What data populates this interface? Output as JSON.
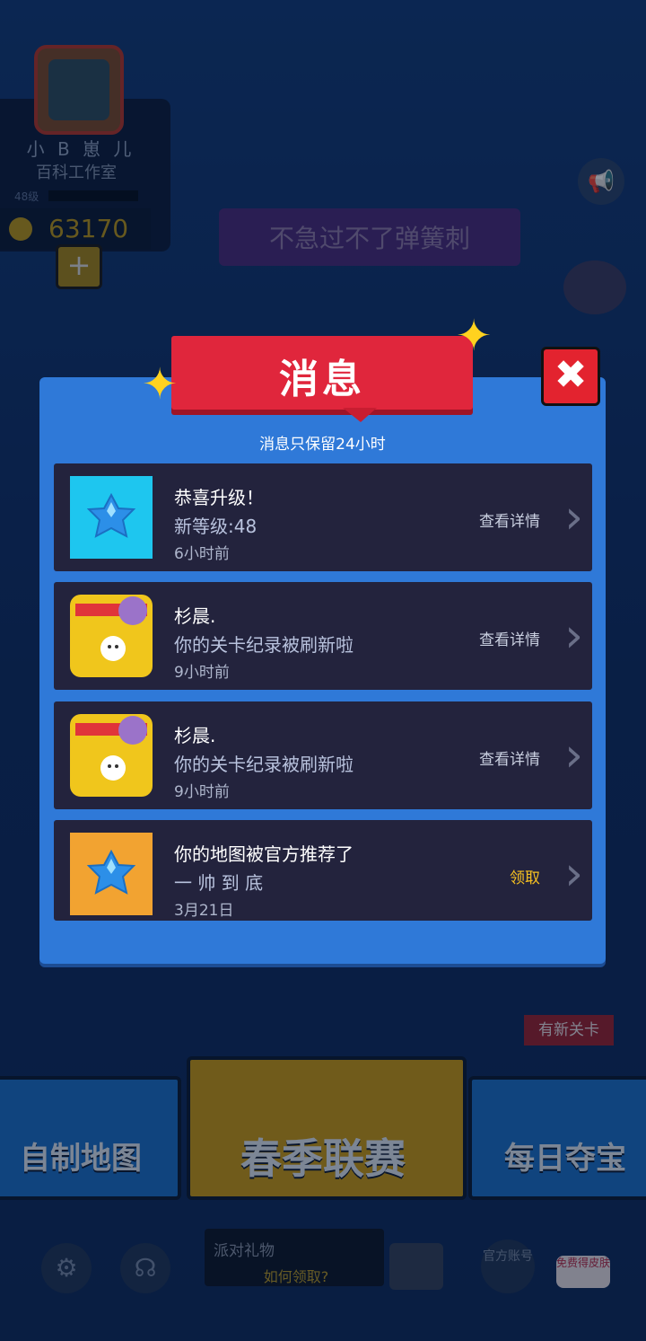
{
  "profile": {
    "name": "小 B 崽 儿",
    "studio": "百科工作室",
    "level": "48级",
    "coins": "63170",
    "add": "+"
  },
  "announcement": "不急过不了弹簧刺",
  "speaker_icon": "speaker-icon",
  "modal": {
    "title": "消息",
    "subtitle": "消息只保留24小时",
    "close": "✖",
    "messages": [
      {
        "icon": "blue-gem-icon",
        "title": "恭喜升级！",
        "body": "新等级:48",
        "time": "6小时前",
        "action": "查看详情"
      },
      {
        "icon": "party-level-icon",
        "title": "杉晨.",
        "body": "你的关卡纪录被刷新啦",
        "time": "9小时前",
        "action": "查看详情"
      },
      {
        "icon": "party-level-icon",
        "title": "杉晨.",
        "body": "你的关卡纪录被刷新啦",
        "time": "9小时前",
        "action": "查看详情"
      },
      {
        "icon": "blue-gem-icon",
        "title": "你的地图被官方推荐了",
        "body": "一 帅 到 底",
        "time": "3月21日",
        "action": "领取"
      }
    ]
  },
  "bottom": {
    "diy": "自制地图",
    "spring": "春季联赛",
    "daily": "每日夺宝",
    "new_level": "有新关卡",
    "party_title": "派对礼物",
    "party_sub": "如何领取?",
    "official": "官方账号",
    "free": "免费得皮肤"
  },
  "colors": {
    "modal": "#2f79d8",
    "ribbon": "#e0263c",
    "row": "#23233d",
    "gold": "#f5c021"
  }
}
